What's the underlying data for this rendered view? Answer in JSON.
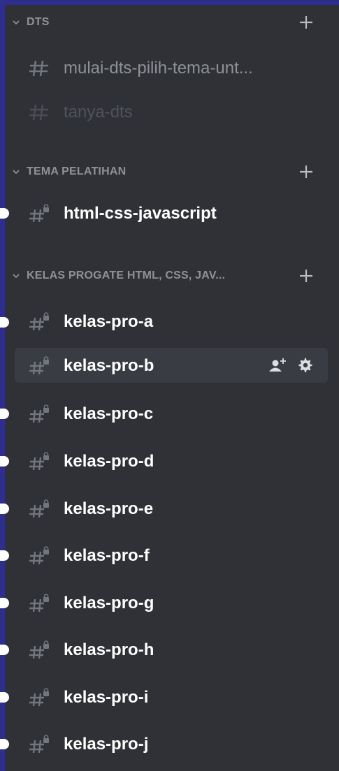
{
  "categories": [
    {
      "label": "DTS",
      "channels": [
        {
          "name": "mulai-dts-pilih-tema-unt...",
          "style": "muted",
          "locked": false
        },
        {
          "name": "tanya-dts",
          "style": "dim",
          "locked": false
        }
      ]
    },
    {
      "label": "TEMA PELATIHAN",
      "channels": [
        {
          "name": "html-css-javascript",
          "style": "white",
          "locked": true,
          "unread": true
        }
      ]
    },
    {
      "label": "KELAS PROGATE HTML, CSS, JAV...",
      "channels": [
        {
          "name": "kelas-pro-a",
          "style": "white",
          "locked": true,
          "unread": true
        },
        {
          "name": "kelas-pro-b",
          "style": "white",
          "locked": true,
          "active": true
        },
        {
          "name": "kelas-pro-c",
          "style": "white",
          "locked": true,
          "unread": true
        },
        {
          "name": "kelas-pro-d",
          "style": "white",
          "locked": true,
          "unread": true
        },
        {
          "name": "kelas-pro-e",
          "style": "white",
          "locked": true,
          "unread": true
        },
        {
          "name": "kelas-pro-f",
          "style": "white",
          "locked": true,
          "unread": true
        },
        {
          "name": "kelas-pro-g",
          "style": "white",
          "locked": true,
          "unread": true
        },
        {
          "name": "kelas-pro-h",
          "style": "white",
          "locked": true,
          "unread": true
        },
        {
          "name": "kelas-pro-i",
          "style": "white",
          "locked": true,
          "unread": true
        },
        {
          "name": "kelas-pro-j",
          "style": "white",
          "locked": true,
          "unread": true
        }
      ]
    }
  ],
  "icons": {
    "category_collapse": "chevron-down-icon",
    "category_add": "plus-icon",
    "text_channel": "hash-icon",
    "private_channel": "hash-lock-icon",
    "invite": "add-user-icon",
    "settings": "gear-icon"
  },
  "colors": {
    "background": "#2f3136",
    "active_row": "#393c43",
    "frame": "#2e2e8c",
    "text_white": "#ffffff",
    "text_muted": "#8e9297",
    "text_dim": "#4f545c"
  }
}
